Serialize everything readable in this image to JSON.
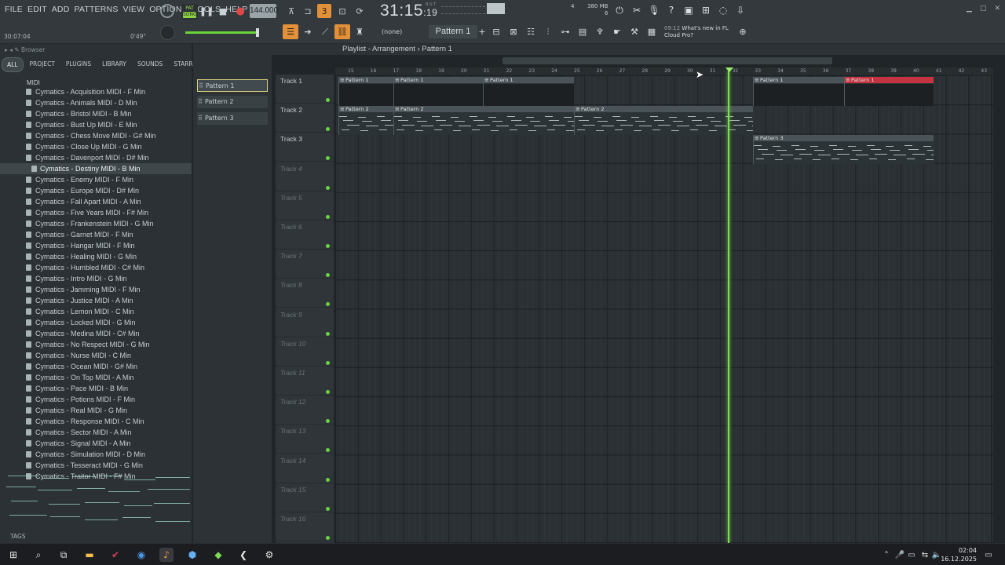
{
  "menu": [
    "FILE",
    "EDIT",
    "ADD",
    "PATTERNS",
    "VIEW",
    "OPTIONS",
    "TOOLS",
    "HELP"
  ],
  "transport": {
    "song_label": "SONG",
    "tempo": "144.000",
    "time_main": "31:15",
    "time_sub": ":19",
    "time_unit": "B:S:T",
    "hint_left": "30:07:04",
    "hint_right": "0'49\"",
    "ram": "380 MB",
    "ram_sub": "6",
    "cpu_num": "4"
  },
  "toolbar2": {
    "channel_select": "(none)",
    "pattern_select": "Pattern 1",
    "news_time": "09:12",
    "news_text_1": "What's new in FL",
    "news_text_2": "Cloud Pro?"
  },
  "browser": {
    "title": "Browser",
    "tabs": [
      "ALL",
      "PROJECT",
      "PLUGINS",
      "LIBRARY",
      "SOUNDS",
      "STARRED"
    ],
    "folder": "MIDI",
    "items": [
      "Cymatics - Acquisition MIDI - F Min",
      "Cymatics - Animals MIDI - D Min",
      "Cymatics - Bristol MIDI - B Min",
      "Cymatics - Bust Up MIDI - E Min",
      "Cymatics - Chess Move MIDI - G# Min",
      "Cymatics - Close Up MIDI - G Min",
      "Cymatics - Davenport MIDI - D# Min",
      "Cymatics - Destiny MIDI - B Min",
      "Cymatics - Enemy MIDI - F Min",
      "Cymatics - Europe MIDI - D# Min",
      "Cymatics - Fall Apart MIDI - A Min",
      "Cymatics - Five Years MIDI - F# Min",
      "Cymatics - Frankenstein MIDI - G Min",
      "Cymatics - Garnet MIDI - F Min",
      "Cymatics - Hangar MIDI - F Min",
      "Cymatics - Healing MIDI - G Min",
      "Cymatics - Humbled MIDI - C# Min",
      "Cymatics - Intro MIDI - G Min",
      "Cymatics - Jamming MIDI - F Min",
      "Cymatics - Justice MIDI - A Min",
      "Cymatics - Lemon MIDI - C Min",
      "Cymatics - Locked MIDI - G Min",
      "Cymatics - Medina MIDI - C# Min",
      "Cymatics - No Respect MIDI - G Min",
      "Cymatics - Nurse MIDI - C Min",
      "Cymatics - Ocean MIDI - G# Min",
      "Cymatics - On Top MIDI - A Min",
      "Cymatics - Pace MIDI - B Min",
      "Cymatics - Potions MIDI - F Min",
      "Cymatics - Real MIDI - G Min",
      "Cymatics - Response MIDI - C Min",
      "Cymatics - Sector MIDI - A Min",
      "Cymatics - Signal MIDI - A Min",
      "Cymatics - Simulation MIDI - D Min",
      "Cymatics - Tesseract MIDI - G Min",
      "Cymatics - Traitor MIDI - F# Min"
    ],
    "tags_label": "TAGS"
  },
  "playlist": {
    "title": "Playlist - Arrangement",
    "current_pattern": "Pattern 1",
    "patterns": [
      "Pattern 1",
      "Pattern 2",
      "Pattern 3"
    ],
    "tracks": [
      "Track 1",
      "Track 2",
      "Track 3",
      "Track 4",
      "Track 5",
      "Track 6",
      "Track 7",
      "Track 8",
      "Track 9",
      "Track 10",
      "Track 11",
      "Track 12",
      "Track 13",
      "Track 14",
      "Track 15",
      "Track 16"
    ],
    "ruler_bars": [
      "15",
      "16",
      "17",
      "18",
      "19",
      "20",
      "21",
      "22",
      "23",
      "24",
      "25",
      "26",
      "27",
      "28",
      "29",
      "30",
      "31",
      "32",
      "33",
      "34",
      "35",
      "36",
      "37",
      "38",
      "39",
      "40",
      "41",
      "42",
      "43"
    ],
    "clip_labels": {
      "t1": [
        "Pattern 1",
        "Pattern 1",
        "Pattern 1",
        "Pattern 1",
        "Pattern 1"
      ],
      "t2": [
        "Pattern 2",
        "Pattern 2",
        "Pattern 2"
      ],
      "t3": [
        "Pattern 3"
      ]
    }
  },
  "taskbar": {
    "time": "02:04",
    "date": "16.12.2025"
  }
}
